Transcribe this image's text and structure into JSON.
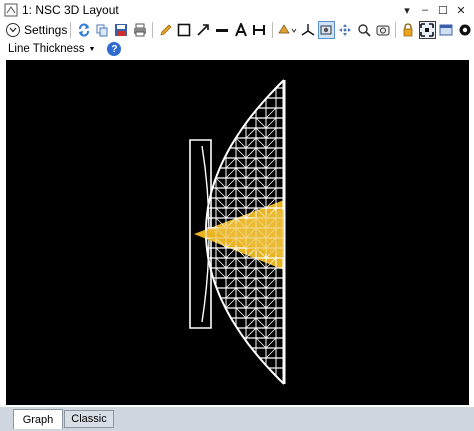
{
  "window": {
    "title": "1: NSC 3D Layout",
    "controls": [
      "▾",
      "–",
      "☐",
      "✕"
    ]
  },
  "toolbar": {
    "settings_label": "Settings",
    "settings_icon": "chevron-circle-icon",
    "icons": [
      "refresh-icon",
      "copy-icon",
      "save-icon",
      "print-icon",
      "pencil-icon",
      "rectangle-icon",
      "arrow-icon",
      "line-icon",
      "text-icon",
      "dimension-icon",
      "rotate-dropdown-icon",
      "axes-icon",
      "camera-icon",
      "move-icon",
      "zoom-icon",
      "screenshot-icon",
      "lock-icon",
      "fit-icon",
      "window-icon",
      "settings-gear-icon"
    ]
  },
  "toolbar2": {
    "line_thickness_label": "Line Thickness",
    "help_label": "?"
  },
  "tabs": [
    {
      "label": "Graph",
      "active": true
    },
    {
      "label": "Classic",
      "active": false
    }
  ],
  "colors": {
    "canvas_bg": "#000000",
    "wire": "#ffffff",
    "rays": "#e8b321"
  }
}
